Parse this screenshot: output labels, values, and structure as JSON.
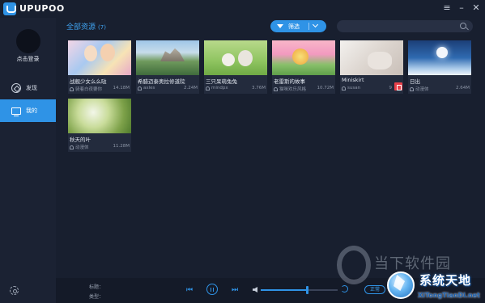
{
  "titlebar": {
    "app_name": "UPUPOO",
    "controls": [
      "menu-icon",
      "minimize-icon",
      "close-icon"
    ],
    "control_glyphs": [
      "≡",
      "–",
      "✕"
    ]
  },
  "sidebar": {
    "login_label": "点击登录",
    "items": [
      {
        "label": "发现",
        "icon": "compass-icon",
        "active": false
      },
      {
        "label": "我的",
        "icon": "monitor-icon",
        "active": true
      }
    ]
  },
  "main": {
    "heading": "全部资源",
    "count": "(7)",
    "filter_label": "筛选",
    "search_placeholder": "",
    "cards": [
      {
        "title": "战舰少女么么哒",
        "author": "骑着白夜要你",
        "size": "14.18M"
      },
      {
        "title": "希腊迈泰奥拉修道院",
        "author": "axles",
        "size": "2.24M"
      },
      {
        "title": "三只呆萌兔兔",
        "author": "mindpx",
        "size": "3.76M"
      },
      {
        "title": "老雷斯的故事",
        "author": "猫咪欢乐风格",
        "size": "10.72M"
      },
      {
        "title": "Miniskirt",
        "author": "susan",
        "size": "9",
        "delete": true
      },
      {
        "title": "日出",
        "author": "动漫体",
        "size": "2.64M"
      },
      {
        "title": "秋天的叶",
        "author": "动漫体",
        "size": "11.28M"
      }
    ]
  },
  "player": {
    "title_label": "标题：",
    "type_label": "类型：",
    "prev_glyph": "⏮",
    "next_glyph": "⏭",
    "volume_level": 0.6,
    "mode_label": "正常"
  },
  "watermark": {
    "text": "当下软件园",
    "badge_title": "系统天地",
    "badge_url": "XiTongTianDi.net"
  },
  "colors": {
    "accent": "#2f93e6",
    "background": "#181f2f",
    "sidebar": "#1b2233",
    "danger": "#e8404a"
  }
}
